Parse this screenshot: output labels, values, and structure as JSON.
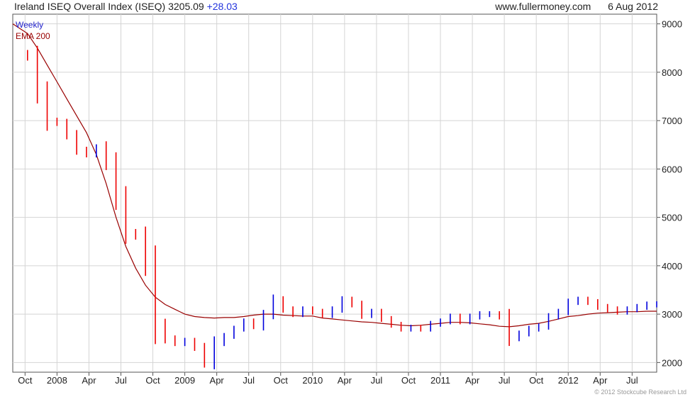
{
  "header": {
    "title": "Ireland ISEQ Overall Index (ISEQ) 3205.09",
    "change": "+28.03",
    "site": "www.fullermoney.com",
    "date": "6 Aug 2012"
  },
  "legend": {
    "series1": "Weekly",
    "series2": "EMA 200"
  },
  "copyright": "© 2012 Stockcube Research Ltd",
  "colors": {
    "up": "#0000dd",
    "down": "#ee0000",
    "ema": "#990000",
    "grid": "#d4d4d4"
  },
  "chart_data": {
    "type": "line",
    "title": "Ireland ISEQ Overall Index (ISEQ)",
    "xlabel": "",
    "ylabel": "",
    "ylim": [
      1800,
      9200
    ],
    "y_ticks": [
      2000,
      3000,
      4000,
      5000,
      6000,
      7000,
      8000,
      9000
    ],
    "x_tick_labels": [
      "Oct",
      "2008",
      "Apr",
      "Jul",
      "Oct",
      "2009",
      "Apr",
      "Jul",
      "Oct",
      "2010",
      "Apr",
      "Jul",
      "Oct",
      "2011",
      "Apr",
      "Jul",
      "Oct",
      "2012",
      "Apr",
      "Jul"
    ],
    "x_range_weeks": [
      0,
      262
    ],
    "x_tick_weeks": [
      5,
      18,
      31,
      44,
      57,
      70,
      83,
      96,
      109,
      122,
      135,
      148,
      161,
      174,
      187,
      200,
      213,
      226,
      239,
      252
    ],
    "weeks": [
      0,
      6,
      10,
      14,
      18,
      22,
      26,
      30,
      34,
      38,
      42,
      46,
      50,
      54,
      58,
      62,
      66,
      70,
      74,
      78,
      82,
      86,
      90,
      94,
      98,
      102,
      106,
      110,
      114,
      118,
      122,
      126,
      130,
      134,
      138,
      142,
      146,
      150,
      154,
      158,
      162,
      166,
      170,
      174,
      178,
      182,
      186,
      190,
      194,
      198,
      202,
      206,
      210,
      214,
      218,
      222,
      226,
      230,
      234,
      238,
      242,
      246,
      250,
      254,
      258,
      262
    ],
    "series": [
      {
        "name": "Weekly",
        "values": [
          8400,
          8300,
          7600,
          7000,
          6950,
          6700,
          6400,
          6300,
          6450,
          6100,
          5400,
          4700,
          4600,
          4000,
          2800,
          2500,
          2400,
          2450,
          2300,
          2000,
          2400,
          2550,
          2700,
          2850,
          2750,
          3000,
          3300,
          3100,
          3000,
          3100,
          3050,
          2980,
          3100,
          3300,
          3200,
          2980,
          3050,
          2900,
          2780,
          2700,
          2720,
          2700,
          2800,
          2850,
          2950,
          2850,
          2950,
          3000,
          3000,
          2950,
          2500,
          2600,
          2700,
          2750,
          2950,
          3050,
          3250,
          3300,
          3250,
          3150,
          3100,
          3050,
          3100,
          3150,
          3200,
          3205
        ]
      },
      {
        "name": "EMA 200",
        "values": [
          9000,
          8800,
          8500,
          8150,
          7800,
          7450,
          7100,
          6750,
          6300,
          5700,
          5000,
          4400,
          3950,
          3600,
          3350,
          3200,
          3100,
          3000,
          2950,
          2930,
          2920,
          2930,
          2930,
          2950,
          2980,
          3000,
          3000,
          2980,
          2970,
          2960,
          2960,
          2920,
          2900,
          2880,
          2860,
          2840,
          2830,
          2810,
          2790,
          2770,
          2760,
          2770,
          2790,
          2810,
          2830,
          2830,
          2820,
          2800,
          2780,
          2750,
          2740,
          2760,
          2790,
          2810,
          2850,
          2900,
          2950,
          2970,
          3000,
          3020,
          3030,
          3040,
          3050,
          3050,
          3060,
          3060
        ]
      }
    ]
  }
}
